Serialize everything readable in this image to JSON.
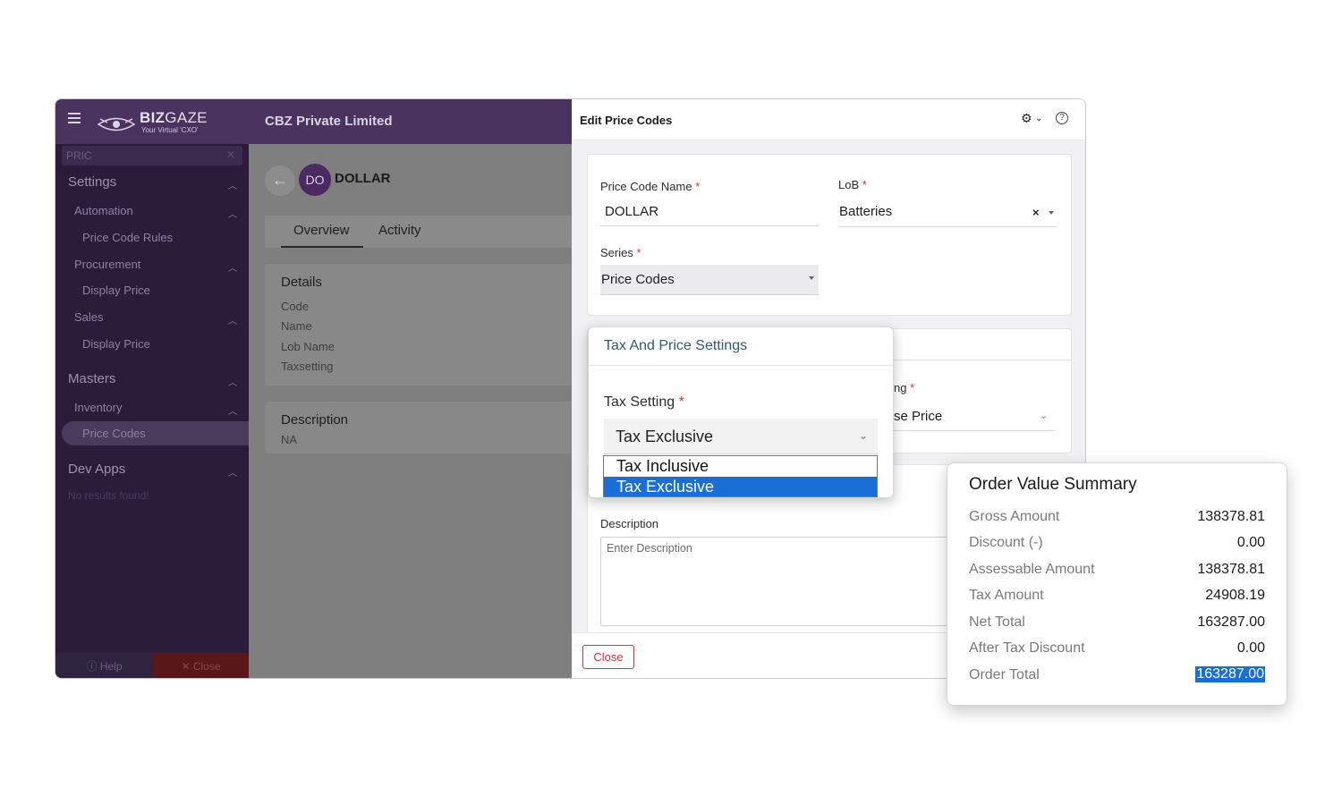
{
  "topbar": {
    "brand_bold": "BIZ",
    "brand_light": "GAZE",
    "tagline": "Your Virtual 'CXO'",
    "company": "CBZ Private Limited"
  },
  "sidebar": {
    "search_value": "PRIC",
    "settings_heading": "Settings",
    "automation": "Automation",
    "price_code_rules": "Price Code Rules",
    "procurement": "Procurement",
    "display_price_1": "Display Price",
    "sales": "Sales",
    "display_price_2": "Display Price",
    "masters_heading": "Masters",
    "inventory": "Inventory",
    "price_codes": "Price Codes",
    "dev_apps_heading": "Dev Apps",
    "no_results": "No results found!",
    "help": "Help",
    "close": "Close"
  },
  "record": {
    "avatar": "DO",
    "title": "DOLLAR",
    "tabs": [
      "Overview",
      "Activity"
    ],
    "details_heading": "Details",
    "detail_fields": [
      "Code",
      "Name",
      "Lob Name",
      "Taxsetting"
    ],
    "description_heading": "Description",
    "description_value": "NA"
  },
  "panel": {
    "title": "Edit Price Codes",
    "price_code_name_label": "Price Code Name",
    "price_code_name_value": "DOLLAR",
    "lob_label": "LoB",
    "lob_value": "Batteries",
    "lob_clear": "×",
    "series_label": "Series",
    "series_value": "Price Codes",
    "pricing_label_partial": "ng",
    "pricing_value_partial": "se Price",
    "description_label": "Description",
    "description_placeholder": "Enter Description",
    "close_button": "Close",
    "required_mark": "*"
  },
  "tax_popup": {
    "title": "Tax And Price Settings",
    "tax_setting_label": "Tax Setting",
    "selected": "Tax Exclusive",
    "options": [
      "Tax Inclusive",
      "Tax Exclusive"
    ]
  },
  "summary": {
    "title": "Order Value Summary",
    "rows": [
      {
        "label": "Gross Amount",
        "value": "138378.81"
      },
      {
        "label": "Discount (-)",
        "value": "0.00"
      },
      {
        "label": "Assessable Amount",
        "value": "138378.81"
      },
      {
        "label": "Tax Amount",
        "value": "24908.19"
      },
      {
        "label": "Net Total",
        "value": "163287.00"
      },
      {
        "label": "After Tax Discount",
        "value": "0.00"
      },
      {
        "label": "Order Total",
        "value": "163287.00"
      }
    ]
  },
  "colors": {
    "brand_purple": "#4b3360",
    "highlight_blue": "#1a6fd6",
    "required_red": "#e03131"
  }
}
